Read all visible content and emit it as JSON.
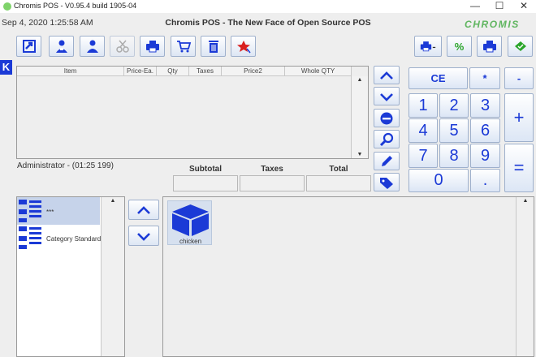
{
  "window": {
    "title": "Chromis POS - V0.95.4 build 1905-04",
    "minimize": "—",
    "maximize": "☐",
    "close": "✕"
  },
  "header": {
    "datetime": "Sep 4, 2020  1:25:58 AM",
    "title": "Chromis POS - The New Face of Open Source POS",
    "logo": "CHROMIS"
  },
  "toolbar": [
    "refresh-icon",
    "customer-icon",
    "user-icon",
    "cut-icon",
    "printer-icon",
    "cart-icon",
    "trash-icon",
    "pin-icon"
  ],
  "side_tab": "K",
  "ticket": {
    "columns": [
      "Item",
      "Price-Ea.",
      "Qty",
      "Taxes",
      "Price2",
      "Whole QTY"
    ],
    "scroll_up": "▲",
    "scroll_down": "▼"
  },
  "status": {
    "user": "Administrator - (01:25 199)"
  },
  "totals": {
    "subtotal_label": "Subtotal",
    "taxes_label": "Taxes",
    "total_label": "Total",
    "subtotal": "",
    "taxes": "",
    "total": ""
  },
  "keypad": {
    "ce": "CE",
    "multiply": "*",
    "minus": "-",
    "plus": "+",
    "equals": "=",
    "digits": [
      "1",
      "2",
      "3",
      "4",
      "5",
      "6",
      "7",
      "8",
      "9"
    ],
    "zero": "0",
    "dot": "."
  },
  "top_right": {
    "percent": "%"
  },
  "categories": {
    "items": [
      {
        "label": "***"
      },
      {
        "label": "Category Standard"
      }
    ],
    "scroll_up": "▲"
  },
  "products": {
    "items": [
      {
        "label": "chicken"
      }
    ],
    "scroll_up": "▲"
  },
  "colors": {
    "accent": "#1b3ad6",
    "selected": "#c6d3ea",
    "logo": "#5fb55f"
  }
}
